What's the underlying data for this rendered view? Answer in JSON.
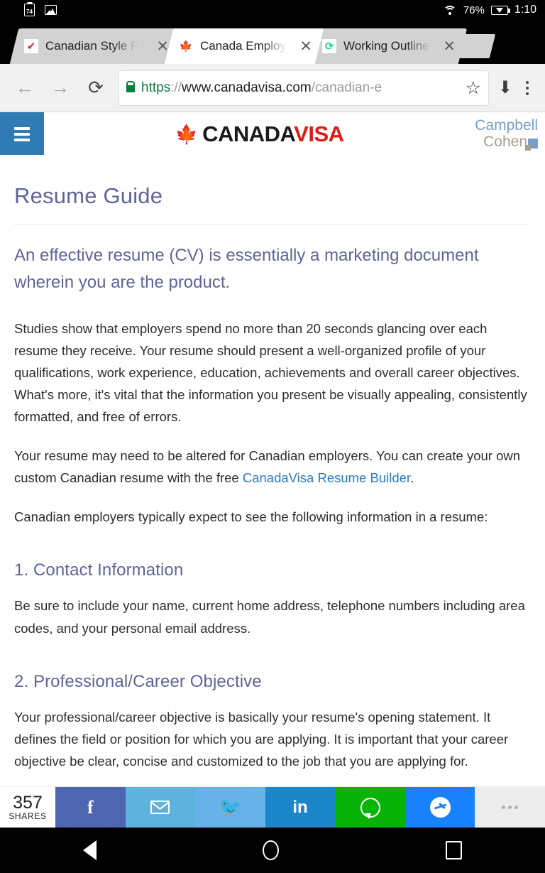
{
  "statusbar": {
    "clipboard_badge": "74",
    "clipboard_icon": "clipboard-icon",
    "image_icon": "image-icon",
    "wifi_icon": "wifi-icon",
    "battery_percent": "76%",
    "battery_icon": "battery-charging-icon",
    "time": "1:10"
  },
  "browser": {
    "tabs": [
      {
        "title": "Canadian Style R",
        "favicon": "red-checkmark-favicon",
        "favicon_glyph": "✔",
        "active": false,
        "close_label": "✕"
      },
      {
        "title": "Canada Employm",
        "favicon": "maple-leaf-favicon",
        "favicon_glyph": "🍁",
        "active": true,
        "close_label": "✕"
      },
      {
        "title": "Working Outline t",
        "favicon": "teal-spiral-favicon",
        "favicon_glyph": "⟳",
        "active": false,
        "close_label": "✕"
      }
    ],
    "new_tab_label": "",
    "back_icon": "←",
    "forward_icon": "→",
    "reload_icon": "⟳",
    "lock_icon": "lock-icon",
    "url": {
      "scheme": "https",
      "separator": "://",
      "host": "www.canadavisa.com",
      "path": "/canadian-e",
      "full": "https://www.canadavisa.com/canadian-e"
    },
    "star_icon": "☆",
    "download_icon": "⬇",
    "menu_icon": "overflow-menu-icon"
  },
  "site_header": {
    "menu_button": "hamburger-menu",
    "logo_leaf": "🍁",
    "logo_part1": "CANADA",
    "logo_part2": "VISA",
    "partner_line1": "Campbell",
    "partner_line2": "Cohen"
  },
  "article": {
    "title": "Resume Guide",
    "lede": "An effective resume (CV) is essentially a marketing document wherein you are the product.",
    "paragraph1": "Studies show that employers spend no more than 20 seconds glancing over each resume they receive. Your resume should present a well-organized profile of your qualifications, work experience, education, achievements and overall career objectives. What's more, it's vital that the information you present be visually appealing, consistently formatted, and free of errors.",
    "paragraph2_before": "Your resume may need to be altered for Canadian employers. You can create your own custom Canadian resume with the free ",
    "paragraph2_link": "CanadaVisa Resume Builder",
    "paragraph2_after": ".",
    "paragraph3": "Canadian employers typically expect to see the following information in a resume:",
    "sections": [
      {
        "heading": "1. Contact Information",
        "body": "Be sure to include your name, current home address, telephone numbers including area codes, and your personal email address."
      },
      {
        "heading": "2. Professional/Career Objective",
        "body": "Your professional/career objective is basically your resume's opening statement. It defines the field or position for which you are applying. It is important that your career objective be clear, concise and customized to the job that you are applying for."
      }
    ]
  },
  "sharebar": {
    "count": "357",
    "count_label": "SHARES",
    "buttons": [
      {
        "name": "facebook",
        "glyph": "f"
      },
      {
        "name": "email",
        "glyph": ""
      },
      {
        "name": "twitter",
        "glyph": "🐦"
      },
      {
        "name": "linkedin",
        "glyph": "in"
      },
      {
        "name": "whatsapp",
        "glyph": ""
      },
      {
        "name": "messenger",
        "glyph": ""
      },
      {
        "name": "more",
        "glyph": ""
      }
    ]
  },
  "navbar": {
    "back": "back-icon",
    "home": "home-icon",
    "recents": "recents-icon"
  },
  "colors": {
    "accent_blue": "#2f7cb5",
    "heading_purple": "#5f6498",
    "link_blue": "#2a7ac4",
    "logo_red": "#e01b14"
  }
}
